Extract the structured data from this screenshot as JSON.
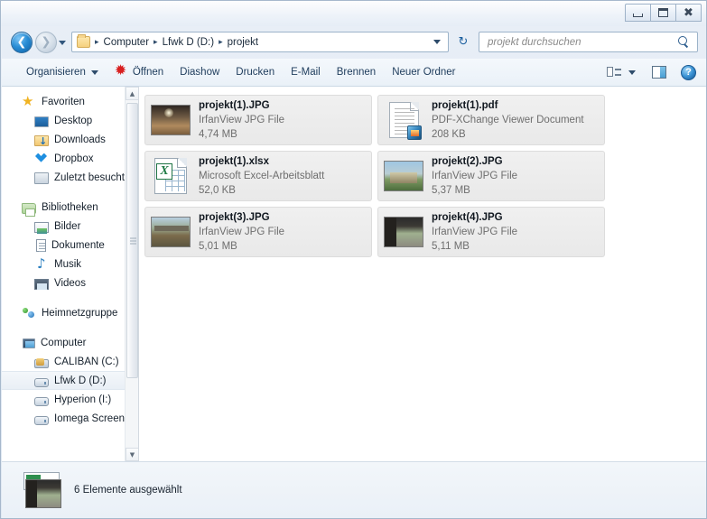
{
  "window": {
    "controls": {
      "minimize": "minimize",
      "maximize": "maximize",
      "close": "close"
    }
  },
  "address": {
    "breadcrumbs": [
      "Computer",
      "Lfwk D (D:)",
      "projekt"
    ],
    "separator": "▸",
    "folder_icon": "folder-icon",
    "dropdown_icon": "chevron-down-icon",
    "refresh_icon": "↻"
  },
  "search": {
    "placeholder": "projekt durchsuchen",
    "icon": "search-icon"
  },
  "toolbar": {
    "organize_label": "Organisieren",
    "open_label": "Öffnen",
    "slideshow_label": "Diashow",
    "print_label": "Drucken",
    "email_label": "E-Mail",
    "burn_label": "Brennen",
    "new_folder_label": "Neuer Ordner",
    "view_icon": "view-list-icon",
    "preview_icon": "preview-pane-icon",
    "help_icon": "help-icon",
    "help_glyph": "?"
  },
  "sidebar": {
    "groups": [
      {
        "header": {
          "label": "Favoriten",
          "icon": "star-icon",
          "icon_class": "ic-star"
        },
        "items": [
          {
            "label": "Desktop",
            "icon": "desktop-icon",
            "icon_class": "ic-desktop"
          },
          {
            "label": "Downloads",
            "icon": "downloads-folder-icon",
            "icon_class": "ic-downloads"
          },
          {
            "label": "Dropbox",
            "icon": "dropbox-icon",
            "icon_class": "ic-dropbox"
          },
          {
            "label": "Zuletzt besucht",
            "icon": "recent-places-icon",
            "icon_class": "ic-recent"
          }
        ]
      },
      {
        "header": {
          "label": "Bibliotheken",
          "icon": "libraries-icon",
          "icon_class": "ic-library"
        },
        "items": [
          {
            "label": "Bilder",
            "icon": "pictures-library-icon",
            "icon_class": "ic-pictures"
          },
          {
            "label": "Dokumente",
            "icon": "documents-library-icon",
            "icon_class": "ic-docs"
          },
          {
            "label": "Musik",
            "icon": "music-library-icon",
            "icon_class": "ic-music"
          },
          {
            "label": "Videos",
            "icon": "videos-library-icon",
            "icon_class": "ic-video"
          }
        ]
      },
      {
        "header": {
          "label": "Heimnetzgruppe",
          "icon": "homegroup-icon",
          "icon_class": "ic-homegroup"
        },
        "items": []
      },
      {
        "header": {
          "label": "Computer",
          "icon": "computer-icon",
          "icon_class": "ic-computer"
        },
        "items": [
          {
            "label": "CALIBAN (C:)",
            "icon": "system-drive-icon",
            "icon_class": "ic-hddsys",
            "selected": false
          },
          {
            "label": "Lfwk D (D:)",
            "icon": "drive-icon",
            "icon_class": "ic-hdd",
            "selected": true
          },
          {
            "label": "Hyperion (I:)",
            "icon": "drive-icon",
            "icon_class": "ic-hdd",
            "selected": false
          },
          {
            "label": "Iomega ScreenPl",
            "icon": "drive-icon",
            "icon_class": "ic-hdd",
            "selected": false
          }
        ]
      }
    ],
    "scroll_up": "▲",
    "scroll_down": "▼"
  },
  "files": [
    {
      "name": "projekt(1).JPG",
      "type": "IrfanView JPG File",
      "size": "4,74 MB",
      "icon": "photo-thumbnail",
      "icon_class": "photo photo-a",
      "selected": true
    },
    {
      "name": "projekt(1).pdf",
      "type": "PDF-XChange Viewer Document",
      "size": "208 KB",
      "icon": "pdf-document-icon",
      "icon_class": "icon-pdf",
      "selected": true
    },
    {
      "name": "projekt(1).xlsx",
      "type": "Microsoft Excel-Arbeitsblatt",
      "size": "52,0 KB",
      "icon": "excel-spreadsheet-icon",
      "icon_class": "icon-xlsx",
      "selected": true
    },
    {
      "name": "projekt(2).JPG",
      "type": "IrfanView JPG File",
      "size": "5,37 MB",
      "icon": "photo-thumbnail",
      "icon_class": "photo photo-b",
      "selected": true
    },
    {
      "name": "projekt(3).JPG",
      "type": "IrfanView JPG File",
      "size": "5,01 MB",
      "icon": "photo-thumbnail",
      "icon_class": "photo photo-c",
      "selected": true
    },
    {
      "name": "projekt(4).JPG",
      "type": "IrfanView JPG File",
      "size": "5,11 MB",
      "icon": "photo-thumbnail",
      "icon_class": "photo photo-d",
      "selected": true
    }
  ],
  "status": {
    "text": "6 Elemente ausgewählt",
    "icon": "selection-preview-icon"
  },
  "colors": {
    "accent": "#2a8ed6",
    "frame": "#a6b8cc",
    "toolbar_text": "#1e3c5c",
    "selection_bg": "#ededed",
    "secondary_text": "#6e6e6e"
  }
}
